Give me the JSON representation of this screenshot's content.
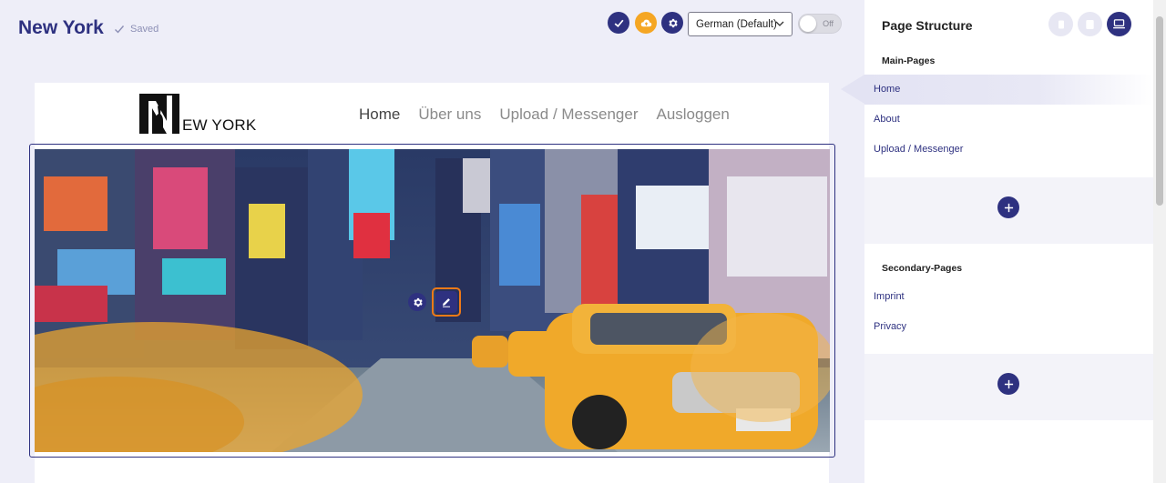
{
  "header": {
    "site_title": "New York",
    "saved_label": "Saved",
    "language_select": "German (Default)",
    "toggle_label": "Off"
  },
  "colors": {
    "brand": "#2e3180",
    "accent_orange": "#ef7a17",
    "sidebar_active": "#e3e3f3"
  },
  "site": {
    "logo_text": "EW YORK",
    "nav": [
      "Home",
      "Über uns",
      "Upload / Messenger",
      "Ausloggen"
    ],
    "active_nav": "Home"
  },
  "sidebar": {
    "title": "Page Structure",
    "main_pages_label": "Main-Pages",
    "main_pages": [
      "Home",
      "About",
      "Upload / Messenger"
    ],
    "secondary_pages_label": "Secondary-Pages",
    "secondary_pages": [
      "Imprint",
      "Privacy"
    ],
    "active_page": "Home"
  },
  "icons": {
    "publish": "check-icon",
    "cloud": "cloud-upload-icon",
    "settings": "gear-icon",
    "devices": [
      "mobile-icon",
      "tablet-icon",
      "desktop-icon"
    ],
    "edit": "pencil-icon",
    "add": "plus-icon"
  }
}
